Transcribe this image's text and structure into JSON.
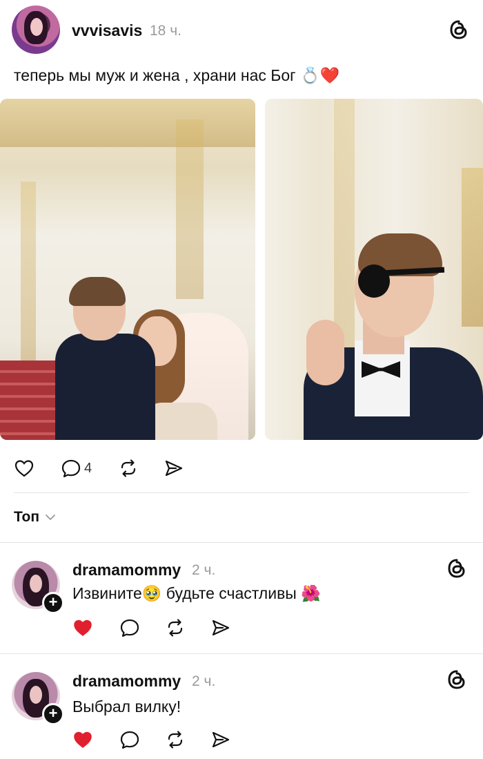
{
  "post": {
    "username": "vvvisavis",
    "time": "18 ч.",
    "text": "теперь мы муж и жена , храни нас Бог 💍❤️",
    "comment_count": "4"
  },
  "sort": {
    "label": "Топ"
  },
  "comments": [
    {
      "username": "dramamommy",
      "time": "2 ч.",
      "text": "Извините🥹 будьте счастливы 🌺",
      "liked": true
    },
    {
      "username": "dramamommy",
      "time": "2 ч.",
      "text": "Выбрал вилку!",
      "liked": true
    }
  ],
  "colors": {
    "like_red": "#e0202f",
    "muted": "#9a9a9a",
    "divider": "#e4e4e4"
  },
  "icons": [
    "threads-icon",
    "heart-icon",
    "comment-icon",
    "repost-icon",
    "share-icon",
    "chevron-down-icon",
    "plus-icon"
  ]
}
